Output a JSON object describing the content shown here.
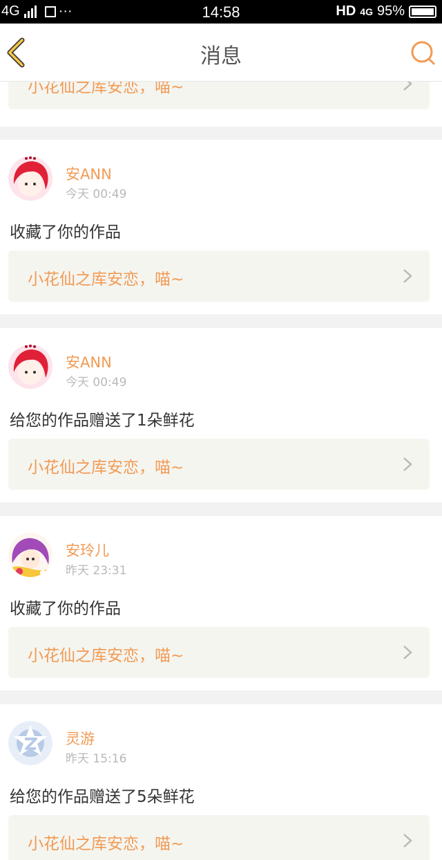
{
  "status_bar": {
    "network": "4G",
    "time": "14:58",
    "hd": "HD",
    "net2": "4G",
    "battery": "95%"
  },
  "nav": {
    "title": "消息",
    "back_icon": "chevron-left-icon",
    "search_icon": "search-icon"
  },
  "colors": {
    "accent": "#f19a54",
    "link_bg": "#f5f5f0",
    "divider": "#f2f2f2"
  },
  "messages": [
    {
      "link_text": "小花仙之库安恋，喵~"
    },
    {
      "user": "安ANN",
      "time": "今天 00:49",
      "text": "收藏了你的作品",
      "link_text": "小花仙之库安恋，喵~"
    },
    {
      "user": "安ANN",
      "time": "今天 00:49",
      "text": "给您的作品赠送了1朵鲜花",
      "link_text": "小花仙之库安恋，喵~"
    },
    {
      "user": "安玲儿",
      "time": "昨天 23:31",
      "text": "收藏了你的作品",
      "link_text": "小花仙之库安恋，喵~"
    },
    {
      "user": "灵游",
      "time": "昨天 15:16",
      "text": "给您的作品赠送了5朵鲜花",
      "link_text": "小花仙之库安恋，喵~"
    }
  ]
}
